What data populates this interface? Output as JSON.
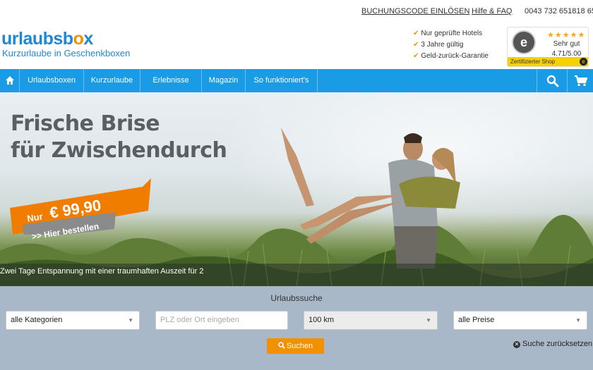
{
  "topbar": {
    "voucher_link": "BUCHUNGSCODE EINLÖSEN",
    "help_link": "Hilfe & FAQ",
    "phone": "0043 732 651818 65"
  },
  "header": {
    "logo_part1": "urlaubsb",
    "logo_o": "o",
    "logo_part2": "x",
    "tagline": "Kurzurlaube in Geschenkboxen",
    "usps": [
      "Nur geprüfte Hotels",
      "3 Jahre gültig",
      "Geld-zurück-Garantie"
    ],
    "trust": {
      "stars": "★★★★★",
      "rating": "Sehr gut",
      "score": "4.71/5.00",
      "footer": "Zertifizierter Shop",
      "seal_letter": "e"
    }
  },
  "nav": {
    "items": [
      "Urlaubsboxen",
      "Kurzurlaube",
      "Erlebnisse",
      "Magazin",
      "So funktioniert's"
    ]
  },
  "hero": {
    "headline_line1": "Frische Brise",
    "headline_line2": "für Zwischendurch",
    "price_prefix": "Nur",
    "price": "€ 99,90",
    "cta": ">> Hier bestellen",
    "caption": "Zwei Tage Entspannung mit einer traumhaften Auszeit für 2"
  },
  "search": {
    "title": "Urlaubssuche",
    "category": "alle Kategorien",
    "location_placeholder": "PLZ oder Ort eingeben",
    "radius": "100 km",
    "price": "alle Preise",
    "submit": "Suchen",
    "reset": "Suche zurücksetzen"
  }
}
